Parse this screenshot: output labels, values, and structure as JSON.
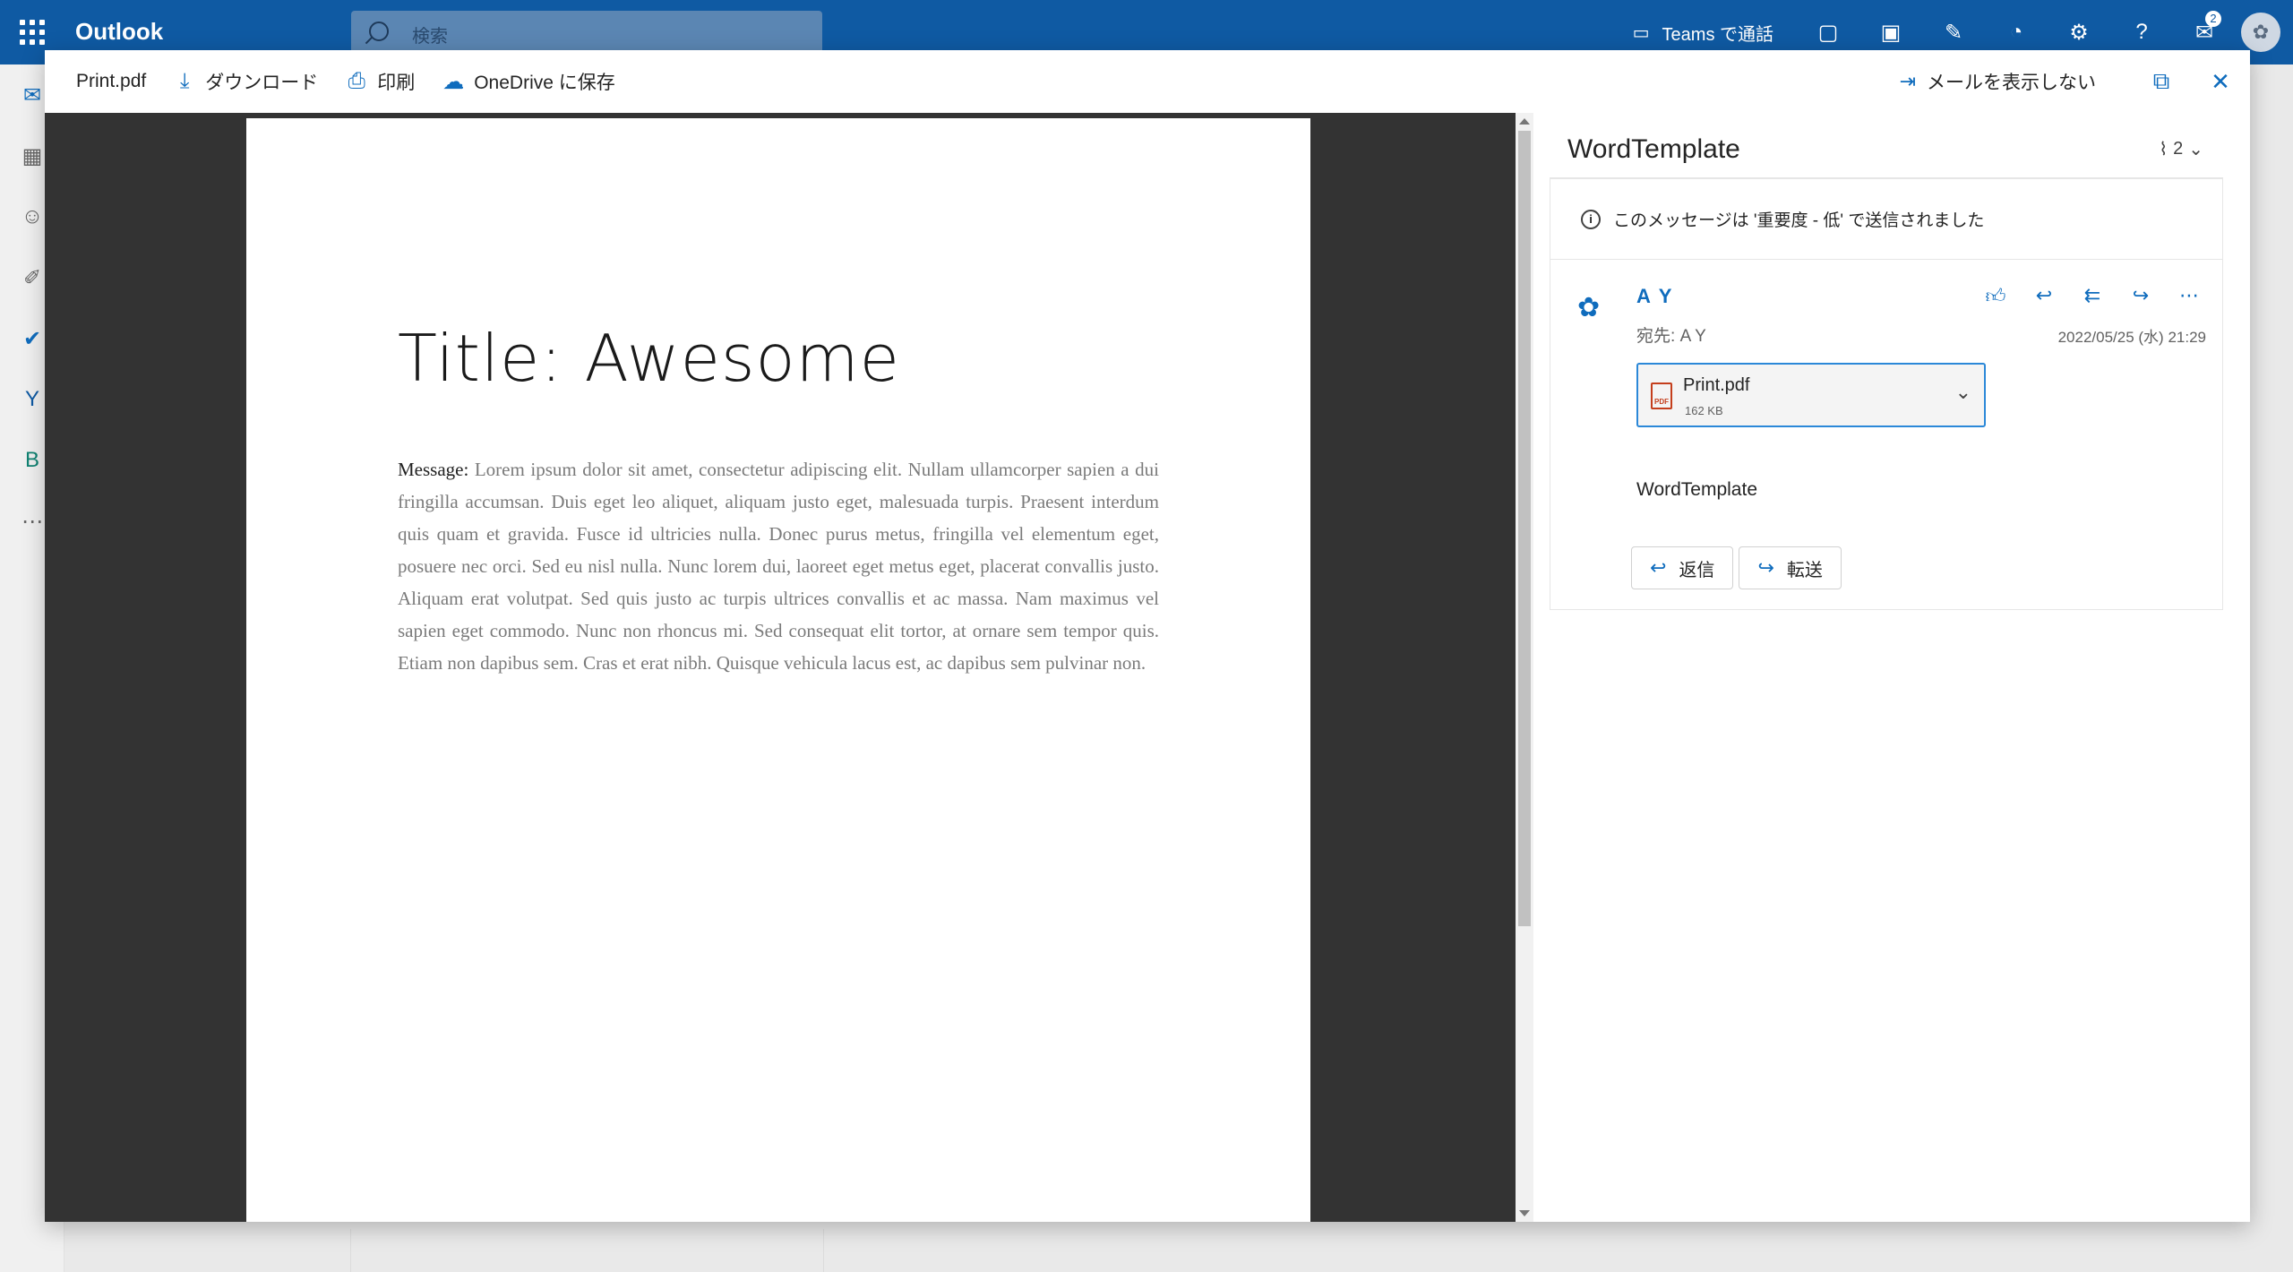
{
  "app": {
    "name": "Outlook"
  },
  "search": {
    "placeholder": "検索"
  },
  "topbar": {
    "teams_label": "Teams で通話",
    "notifications_badge": "2"
  },
  "viewer_toolbar": {
    "file_name": "Print.pdf",
    "download": "ダウンロード",
    "print": "印刷",
    "save_onedrive": "OneDrive に保存",
    "hide_mail": "メールを表示しない"
  },
  "document": {
    "title": "Title: Awesome",
    "message_label": "Message:",
    "message_text": "Lorem ipsum dolor sit amet, consectetur adipiscing elit. Nullam ullamcorper sapien a dui fringilla accumsan. Duis eget leo aliquet, aliquam justo eget, malesuada turpis. Praesent interdum quis quam et gravida. Fusce id ultricies nulla. Donec purus metus, fringilla vel elementum eget, posuere nec orci. Sed eu nisl nulla. Nunc lorem dui, laoreet eget metus eget, placerat convallis justo. Aliquam erat volutpat. Sed quis justo ac turpis ultrices convallis et ac massa. Nam maximus vel sapien eget commodo. Nunc non rhoncus mi. Sed consequat elit tortor, at ornare sem tempor quis. Etiam non dapibus sem. Cras et erat nibh. Quisque vehicula lacus est, ac dapibus sem pulvinar non."
  },
  "mail": {
    "subject": "WordTemplate",
    "attachment_count": "2",
    "importance_notice": "このメッセージは '重要度 - 低' で送信されました",
    "sender": "A Y",
    "to_label": "宛先:",
    "to_value": "A Y",
    "datetime": "2022/05/25 (水) 21:29",
    "attachment": {
      "name": "Print.pdf",
      "size": "162 KB"
    },
    "body": "WordTemplate",
    "reply_label": "返信",
    "forward_label": "転送"
  },
  "colors": {
    "brand_blue": "#0f5aa3",
    "accent": "#0f6cbd",
    "viewer_bg": "#333333"
  }
}
